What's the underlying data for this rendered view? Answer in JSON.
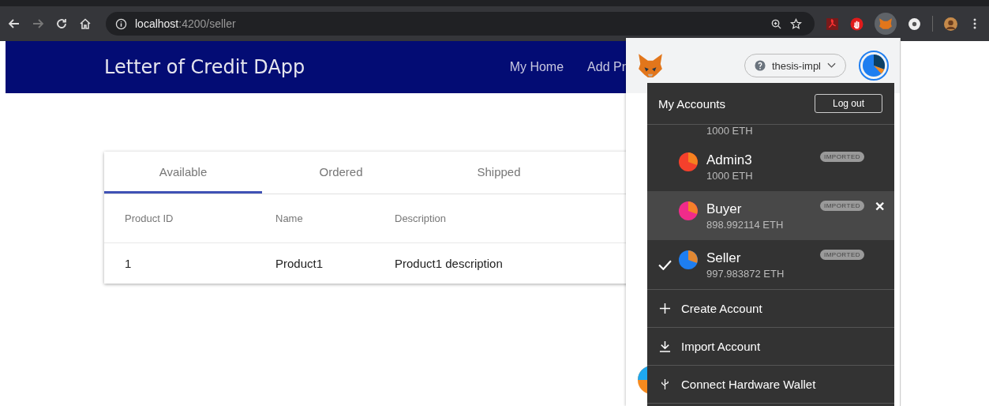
{
  "browser": {
    "address": {
      "host": "localhost",
      "path": ":4200/seller"
    },
    "back_disabled": false,
    "forward_disabled": true
  },
  "app": {
    "title": "Letter of Credit DApp",
    "nav": [
      "My Home",
      "Add Pr"
    ]
  },
  "tabs": [
    {
      "label": "Available",
      "selected": true
    },
    {
      "label": "Ordered",
      "selected": false
    },
    {
      "label": "Shipped",
      "selected": false
    }
  ],
  "table": {
    "columns": [
      "Product ID",
      "Name",
      "Description"
    ],
    "rows": [
      [
        "1",
        "Product1",
        "Product1 description"
      ]
    ]
  },
  "wallet": {
    "network": "thesis-impl",
    "menu": {
      "title": "My Accounts",
      "logout": "Log out",
      "partial_balance": "1000 ETH",
      "accounts": [
        {
          "name": "Admin3",
          "balance": "1000 ETH",
          "tag": "IMPORTED",
          "color": "#f5402c",
          "selected": false,
          "highlighted": false
        },
        {
          "name": "Buyer",
          "balance": "898.992114 ETH",
          "tag": "IMPORTED",
          "color": "#f02b8a",
          "selected": false,
          "highlighted": true,
          "remove": "✕"
        },
        {
          "name": "Seller",
          "balance": "997.983872 ETH",
          "tag": "IMPORTED",
          "color": "#1e7ef0",
          "selected": true,
          "highlighted": false
        }
      ],
      "actions": [
        {
          "kind": "create",
          "label": "Create Account"
        },
        {
          "kind": "import",
          "label": "Import Account"
        },
        {
          "kind": "hardware",
          "label": "Connect Hardware Wallet"
        }
      ]
    }
  }
}
